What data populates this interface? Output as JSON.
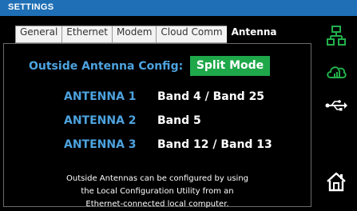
{
  "window": {
    "title": "SETTINGS"
  },
  "tabs": [
    {
      "label": "General"
    },
    {
      "label": "Ethernet"
    },
    {
      "label": "Modem"
    },
    {
      "label": "Cloud Comm"
    },
    {
      "label": "Antenna",
      "active": true
    }
  ],
  "antenna": {
    "config_label": "Outside Antenna Config:",
    "mode": "Split Mode",
    "rows": [
      {
        "name": "ANTENNA 1",
        "bands": "Band 4 / Band 25"
      },
      {
        "name": "ANTENNA 2",
        "bands": "Band 5"
      },
      {
        "name": "ANTENNA 3",
        "bands": "Band 12 / Band 13"
      }
    ],
    "note_lines": [
      "Outside Antennas can be configured by using",
      "the Local Configuration Utility from an",
      "Ethernet-connected local computer."
    ]
  },
  "sidebar": {
    "icons": [
      "network-icon",
      "cloud-signal-icon",
      "usb-icon",
      "home-icon"
    ]
  },
  "colors": {
    "title_bar": "#1e6fb5",
    "accent_blue": "#4da3df",
    "mode_green": "#1fa84a",
    "icon_green": "#22b04a",
    "background": "#000000"
  }
}
